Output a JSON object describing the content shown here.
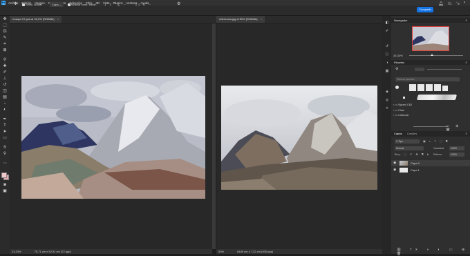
{
  "app": {
    "logo": "Ps"
  },
  "menu": [
    "Archivo",
    "Edición",
    "Imagen",
    "Capa",
    "Texto",
    "Selección",
    "Filtro",
    "3D",
    "Vista",
    "Plugins",
    "Ventana",
    "Ayuda"
  ],
  "options": {
    "auto_select": "Selec. autom.",
    "target": "Capa",
    "show_transform": "Mostrar contr. transf.",
    "share": "Compartir"
  },
  "docs": {
    "left": {
      "tab": "ensayo 07.psd al 33,3% (RGB/8#)",
      "zoom": "33,33%",
      "info": "75,71 cm x 52,91 cm (72 ppp)"
    },
    "right": {
      "tab": "referencia.jpg al 50% (RGB/8#)",
      "zoom": "50%",
      "info": "8449 cm x 7,22 cm (300 ppp)"
    }
  },
  "navigator": {
    "title": "Navegador",
    "zoom": "33,33%"
  },
  "brushes": {
    "title": "Pinceles",
    "search_placeholder": "Buscar pinceles",
    "folders": [
      "Signed CBJ",
      "Chan",
      "Charcoal"
    ]
  },
  "layers": {
    "tabs": [
      "Capas",
      "Canales"
    ],
    "filter": "Tipo",
    "blend_mode": "Normal",
    "opacity_label": "Opacidad:",
    "opacity": "100%",
    "fill_label": "Relleno:",
    "fill": "100%",
    "lock_label": "Bloq.:",
    "items": [
      {
        "name": "Capa 0"
      },
      {
        "name": "Capa 1"
      }
    ]
  },
  "icons": {
    "tools": [
      "move-icon",
      "marquee-icon",
      "lasso-icon",
      "quick-select-icon",
      "crop-icon",
      "frame-icon",
      "eyedropper-icon",
      "healing-icon",
      "brush-icon",
      "stamp-icon",
      "history-brush-icon",
      "eraser-icon",
      "gradient-icon",
      "blur-icon",
      "dodge-icon",
      "pen-icon",
      "type-icon",
      "path-select-icon",
      "shape-icon",
      "hand-icon",
      "zoom-icon"
    ],
    "right_strip": [
      "navigator-icon",
      "brushes-icon",
      "history-icon",
      "properties-icon",
      "adjustments-icon",
      "libraries-icon",
      "layers-icon",
      "channels-icon",
      "paths-icon"
    ]
  },
  "colors": {
    "accent": "#1473e6",
    "bg": "#1e1e1e",
    "panel": "#2f2f2f"
  }
}
